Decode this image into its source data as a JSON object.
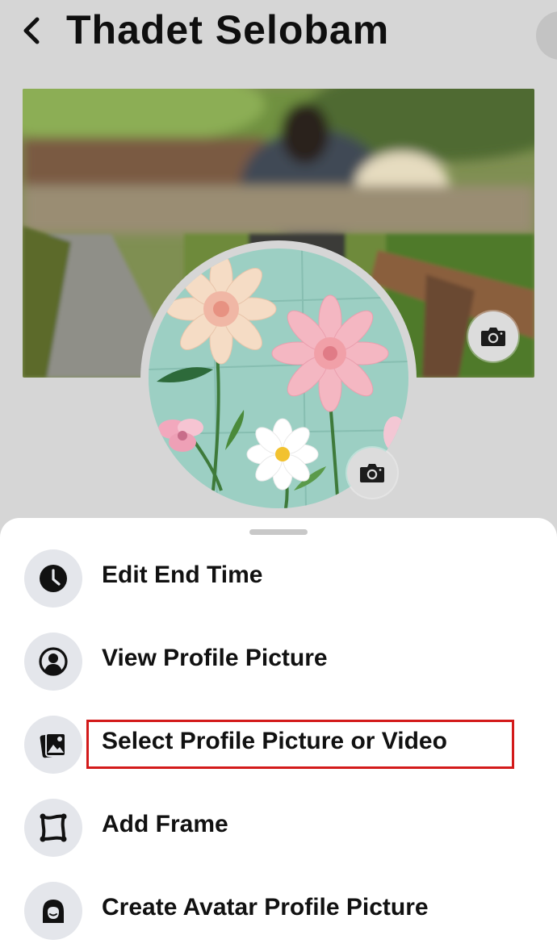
{
  "header": {
    "back_icon": "chevron-left-icon",
    "title": "Thadet Selobam"
  },
  "cover": {
    "camera_icon": "camera-icon"
  },
  "profile_picture": {
    "camera_icon": "camera-icon"
  },
  "menu": {
    "items": [
      {
        "label": "Edit End Time",
        "icon": "clock-icon"
      },
      {
        "label": "View Profile Picture",
        "icon": "user-circle-icon"
      },
      {
        "label": "Select Profile Picture or Video",
        "icon": "photo-gallery-icon"
      },
      {
        "label": "Add Frame",
        "icon": "frame-icon"
      },
      {
        "label": "Create Avatar Profile Picture",
        "icon": "avatar-icon"
      }
    ],
    "highlighted_item": "Select Profile Picture or Video"
  },
  "colors": {
    "highlight_border": "#d31a1a",
    "icon_background": "#e4e6eb",
    "sheet_background": "#ffffff"
  }
}
